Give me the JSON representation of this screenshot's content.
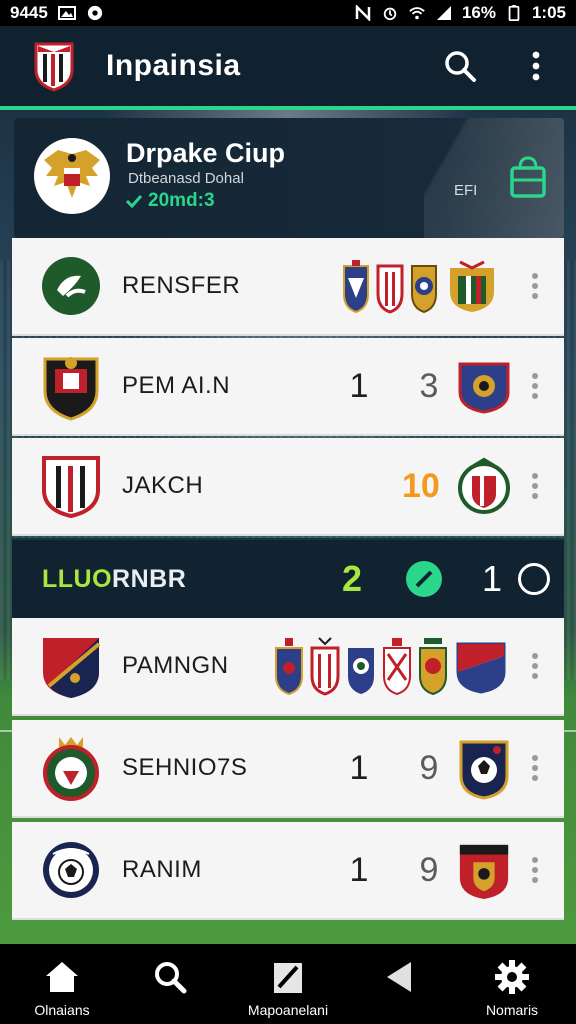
{
  "status_bar": {
    "time_left": "9445",
    "battery": "16%",
    "clock": "1:05"
  },
  "app_bar": {
    "title": "Inpainsia",
    "icons": [
      "club-crest-icon",
      "search-icon",
      "more-vert-icon"
    ],
    "accent": "#2bd58a"
  },
  "club": {
    "name": "Drpake Ciup",
    "subtitle": "Dtbeanasd Dohal",
    "stat": "20md:3",
    "code": "EFI"
  },
  "rows": [
    {
      "name": "RENSFER",
      "s1": "",
      "s2": ""
    },
    {
      "name": "PEM AI.N",
      "s1": "1",
      "s2": "3"
    },
    {
      "name": "JAKCH",
      "s1": "",
      "s2": "10"
    },
    {
      "name": "PAMNGN",
      "s1": "",
      "s2": ""
    },
    {
      "name": "SEHNIO7S",
      "s1": "1",
      "s2": "9"
    },
    {
      "name": "RANIM",
      "s1": "1",
      "s2": "9"
    }
  ],
  "league": {
    "name_green": "LLUO",
    "name_white": "RNBR",
    "score_left": "2",
    "score_right": "1"
  },
  "bottom_nav": [
    {
      "label": "Olnaians",
      "icon": "home-icon"
    },
    {
      "label": "",
      "icon": "search-icon"
    },
    {
      "label": "Mapoanelani",
      "icon": "edit-icon"
    },
    {
      "label": "",
      "icon": "back-icon"
    },
    {
      "label": "Nomaris",
      "icon": "settings-icon"
    }
  ],
  "colors": {
    "accent_green": "#2bd58a",
    "lime": "#a8e83a",
    "orange": "#f39a1e",
    "header": "#102230"
  }
}
